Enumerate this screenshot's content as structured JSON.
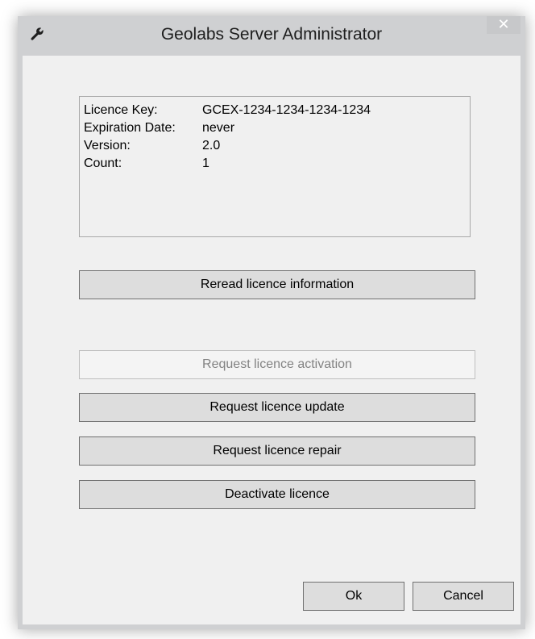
{
  "window": {
    "title": "Geolabs Server Administrator",
    "app_icon": "wrench-icon",
    "close_glyph": "✕"
  },
  "licence_info": {
    "rows": [
      {
        "label": "Licence Key:",
        "value": "GCEX-1234-1234-1234-1234"
      },
      {
        "label": "Expiration Date:",
        "value": "never"
      },
      {
        "label": "Version:",
        "value": "2.0"
      },
      {
        "label": "Count:",
        "value": "1"
      }
    ]
  },
  "buttons": {
    "reread": "Reread licence information",
    "request_activation": "Request licence activation",
    "request_update": "Request licence update",
    "request_repair": "Request licence repair",
    "deactivate": "Deactivate licence",
    "ok": "Ok",
    "cancel": "Cancel"
  },
  "colors": {
    "frame": "#cfd0d2",
    "client_background": "#f0f0f0",
    "button_face": "#dddddd",
    "disabled_text": "#838383"
  }
}
